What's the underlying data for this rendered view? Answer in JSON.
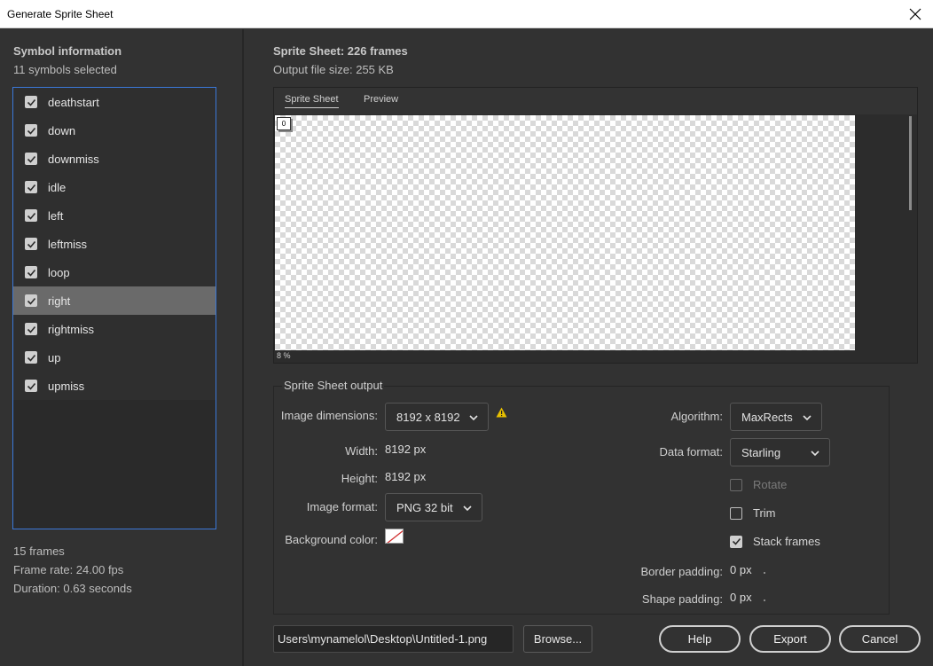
{
  "window": {
    "title": "Generate Sprite Sheet"
  },
  "left": {
    "heading": "Symbol information",
    "selected_count": "11 symbols selected",
    "symbols": [
      {
        "label": "deathstart",
        "checked": true
      },
      {
        "label": "down",
        "checked": true
      },
      {
        "label": "downmiss",
        "checked": true
      },
      {
        "label": "idle",
        "checked": true
      },
      {
        "label": "left",
        "checked": true
      },
      {
        "label": "leftmiss",
        "checked": true
      },
      {
        "label": "loop",
        "checked": true
      },
      {
        "label": "right",
        "checked": true,
        "selected": true
      },
      {
        "label": "rightmiss",
        "checked": true
      },
      {
        "label": "up",
        "checked": true
      },
      {
        "label": "upmiss",
        "checked": true
      }
    ],
    "frames": "15 frames",
    "frame_rate": "Frame rate: 24.00 fps",
    "duration": "Duration: 0.63 seconds"
  },
  "right": {
    "heading": "Sprite Sheet: 226 frames",
    "file_size": "Output file size: 255 KB",
    "tabs": [
      "Sprite Sheet",
      "Preview"
    ],
    "preview": {
      "frame_label": "0",
      "zoom": "8 %"
    }
  },
  "output": {
    "legend": "Sprite Sheet output",
    "image_dimensions_label": "Image dimensions:",
    "image_dimensions_value": "8192 x 8192",
    "width_label": "Width:",
    "width_value": "8192  px",
    "height_label": "Height:",
    "height_value": "8192  px",
    "image_format_label": "Image format:",
    "image_format_value": "PNG 32 bit",
    "bg_color_label": "Background color:",
    "algorithm_label": "Algorithm:",
    "algorithm_value": "MaxRects",
    "data_format_label": "Data format:",
    "data_format_value": "Starling",
    "rotate_label": "Rotate",
    "trim_label": "Trim",
    "stack_label": "Stack frames",
    "border_padding_label": "Border padding:",
    "border_padding_value": "0  px",
    "shape_padding_label": "Shape padding:",
    "shape_padding_value": "0  px"
  },
  "footer": {
    "path": "Users\\mynamelol\\Desktop\\Untitled-1.png",
    "browse": "Browse...",
    "help": "Help",
    "export": "Export",
    "cancel": "Cancel"
  }
}
